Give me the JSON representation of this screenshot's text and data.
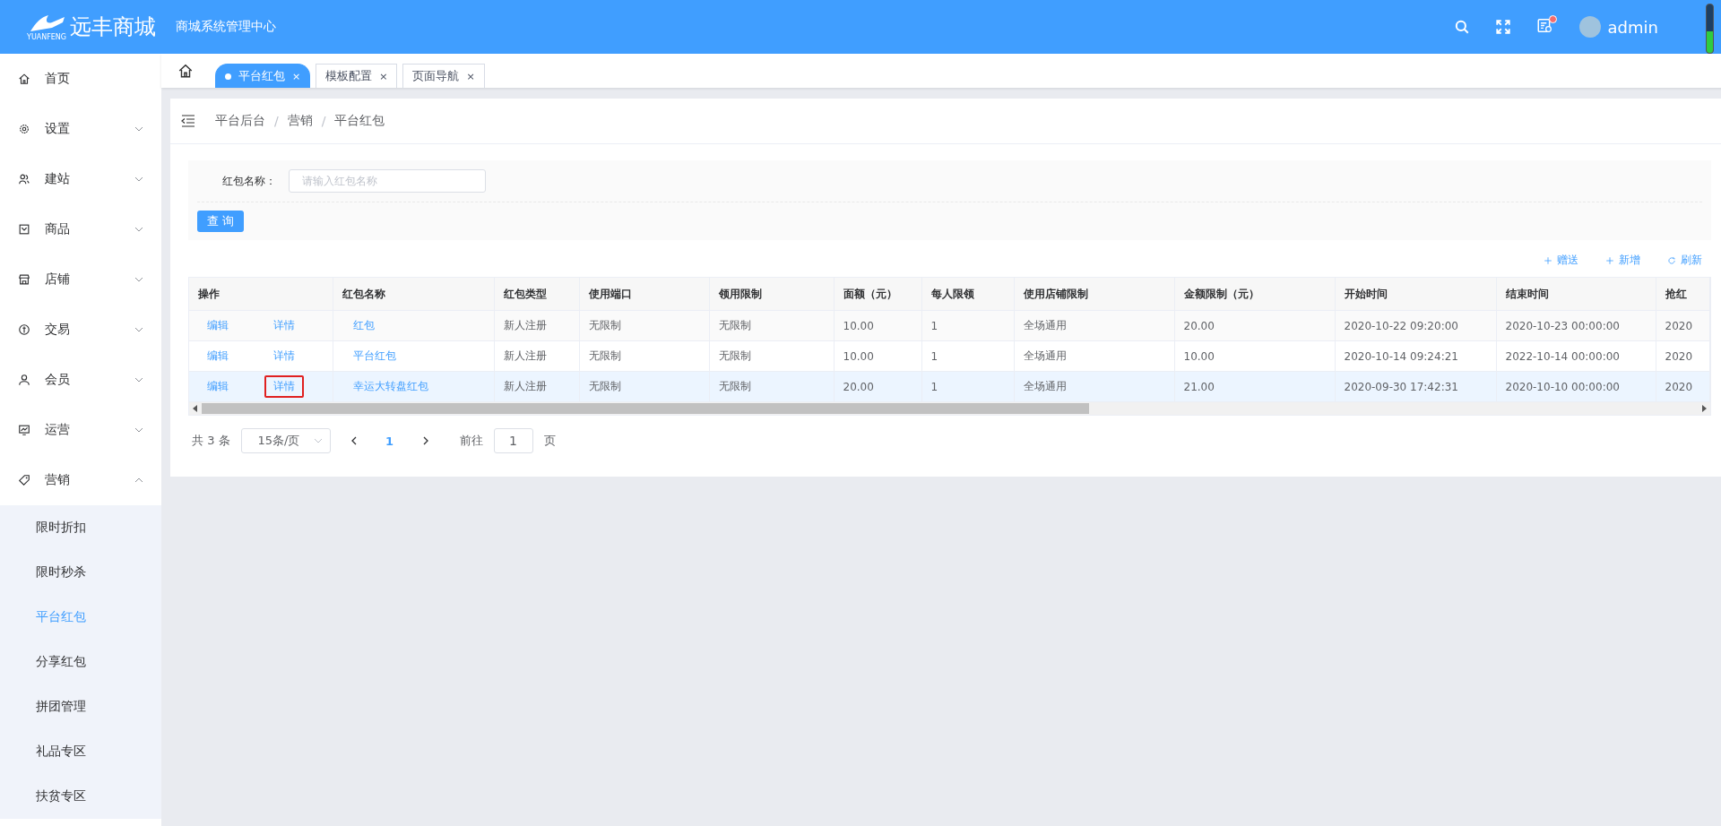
{
  "header": {
    "logo_text": "远丰商城",
    "logo_subtext": "YUANFENG",
    "subtitle": "商城系统管理中心",
    "user": "admin",
    "has_notification": true
  },
  "sidebar": {
    "items": [
      {
        "label": "首页"
      },
      {
        "label": "设置",
        "expanded": false
      },
      {
        "label": "建站",
        "expanded": false
      },
      {
        "label": "商品",
        "expanded": false
      },
      {
        "label": "店铺",
        "expanded": false
      },
      {
        "label": "交易",
        "expanded": false
      },
      {
        "label": "会员",
        "expanded": false
      },
      {
        "label": "运营",
        "expanded": false
      },
      {
        "label": "营销",
        "expanded": true,
        "children": [
          {
            "label": "限时折扣",
            "selected": false
          },
          {
            "label": "限时秒杀",
            "selected": false
          },
          {
            "label": "平台红包",
            "selected": true
          },
          {
            "label": "分享红包",
            "selected": false
          },
          {
            "label": "拼团管理",
            "selected": false
          },
          {
            "label": "礼品专区",
            "selected": false
          },
          {
            "label": "扶贫专区",
            "selected": false
          }
        ]
      }
    ]
  },
  "tabs": [
    {
      "label": "平台红包",
      "selected": true,
      "close": "×"
    },
    {
      "label": "模板配置",
      "selected": false,
      "close": "×"
    },
    {
      "label": "页面导航",
      "selected": false,
      "close": "×"
    }
  ],
  "breadcrumb": [
    "平台后台",
    "营销",
    "平台红包"
  ],
  "breadcrumb_separator": "/",
  "filter": {
    "label": "红包名称：",
    "placeholder": "请输入红包名称",
    "button": "查 询"
  },
  "toolbar": [
    {
      "label": "赠送"
    },
    {
      "label": "新增"
    },
    {
      "label": "刷新"
    }
  ],
  "table": {
    "action_header": "操作",
    "columns": [
      "红包名称",
      "红包类型",
      "使用端口",
      "领用限制",
      "面额（元）",
      "每人限领",
      "使用店铺限制",
      "金额限制（元）",
      "开始时间",
      "结束时间",
      "抢红"
    ],
    "rows": [
      {
        "actions": [
          {
            "label": "编辑",
            "highlighted": false
          },
          {
            "label": "详情",
            "highlighted": false
          }
        ],
        "cells": [
          "红包",
          "新人注册",
          "无限制",
          "无限制",
          "10.00",
          "1",
          "全场通用",
          "20.00",
          "2020-10-22 09:20:00",
          "2020-10-23 00:00:00",
          "2020"
        ],
        "hovered": false
      },
      {
        "actions": [
          {
            "label": "编辑",
            "highlighted": false
          },
          {
            "label": "详情",
            "highlighted": false
          }
        ],
        "cells": [
          "平台红包",
          "新人注册",
          "无限制",
          "无限制",
          "10.00",
          "1",
          "全场通用",
          "10.00",
          "2020-10-14 09:24:21",
          "2022-10-14 00:00:00",
          "2020"
        ],
        "hovered": false
      },
      {
        "actions": [
          {
            "label": "编辑",
            "highlighted": false
          },
          {
            "label": "详情",
            "highlighted": true
          }
        ],
        "cells": [
          "幸运大转盘红包",
          "新人注册",
          "无限制",
          "无限制",
          "20.00",
          "1",
          "全场通用",
          "21.00",
          "2020-09-30 17:42:31",
          "2020-10-10 00:00:00",
          "2020"
        ],
        "hovered": true
      }
    ]
  },
  "pagination": {
    "total": "共 3 条",
    "page_size": "15条/页",
    "pages": [
      {
        "label": "1",
        "selected": true
      }
    ],
    "goto_label": "前往",
    "goto_value": "1",
    "goto_suffix": "页"
  }
}
